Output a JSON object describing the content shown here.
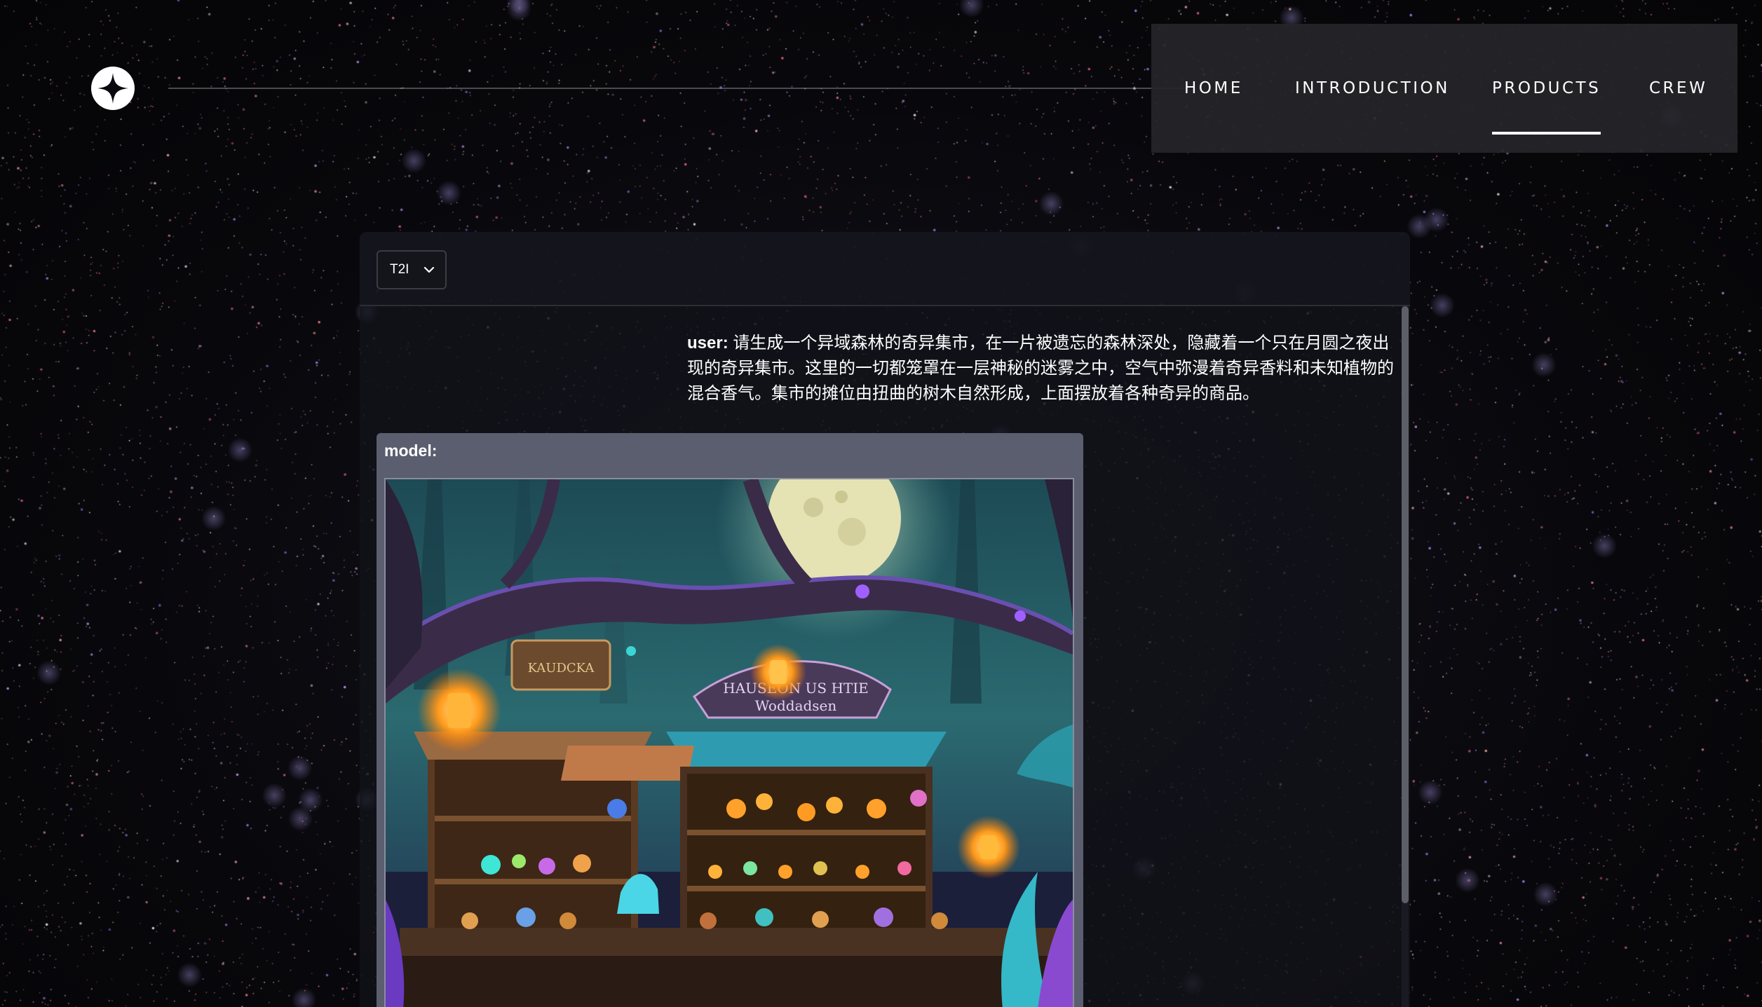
{
  "nav": {
    "items": [
      {
        "label": "HOME",
        "active": false
      },
      {
        "label": "INTRODUCTION",
        "active": false
      },
      {
        "label": "PRODUCTS",
        "active": true
      },
      {
        "label": "CREW",
        "active": false
      }
    ]
  },
  "toolbar": {
    "mode_value": "T2I"
  },
  "chat": {
    "user_label": "user:",
    "user_text": "请生成一个异域森林的奇异集市，在一片被遗忘的森林深处，隐藏着一个只在月圆之夜出现的奇异集市。这里的一切都笼罩在一层神秘的迷雾之中，空气中弥漫着奇异香料和未知植物的混合香气。集市的摊位由扭曲的树木自然形成，上面摆放着各种奇异的商品。",
    "model_label": "model:",
    "image_sign_text_1": "KAUDCKA",
    "image_sign_text_2": "HAUSEON US HTIE",
    "image_sign_text_3": "Woddadsen"
  },
  "colors": {
    "background": "#07070b",
    "nav_background": "#26262a",
    "panel_background": "#12131a",
    "model_card": "#5b5e6f",
    "accent_text": "#ffffff"
  },
  "icons": {
    "logo": "four-point-star-icon",
    "select_caret": "chevron-down-icon"
  }
}
